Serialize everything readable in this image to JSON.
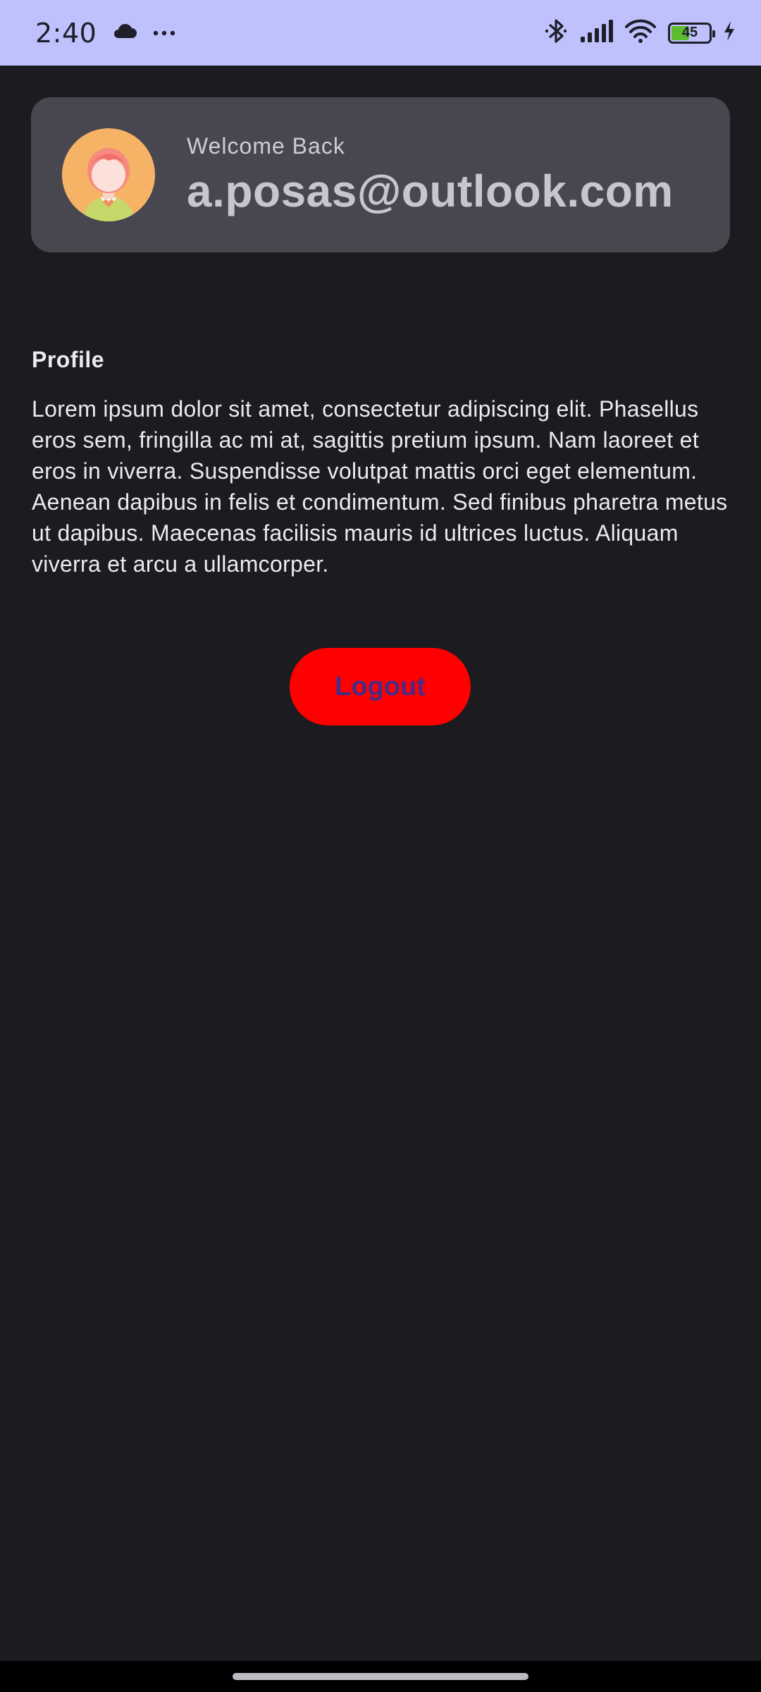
{
  "status_bar": {
    "time": "2:40",
    "battery_level": "45",
    "icons": [
      "cloud-icon",
      "more-dots-icon",
      "bluetooth-icon",
      "signal-icon",
      "wifi-icon",
      "battery-icon",
      "charging-bolt-icon"
    ],
    "background_color": "#bfc1fd"
  },
  "welcome_card": {
    "label": "Welcome Back",
    "email": "a.posas@outlook.com",
    "avatar": "avatar-girl-icon"
  },
  "profile": {
    "title": "Profile",
    "body": "Lorem ipsum dolor sit amet, consectetur adipiscing elit. Phasellus eros sem, fringilla ac mi at, sagittis pretium ipsum. Nam laoreet et eros in viverra. Suspendisse volutpat mattis orci eget elementum. Aenean dapibus in felis et condimentum. Sed finibus pharetra metus ut dapibus. Maecenas facilisis mauris id ultrices luctus. Aliquam viverra et arcu a ullamcorper."
  },
  "logout": {
    "label": "Logout",
    "color": "#ff0000"
  }
}
